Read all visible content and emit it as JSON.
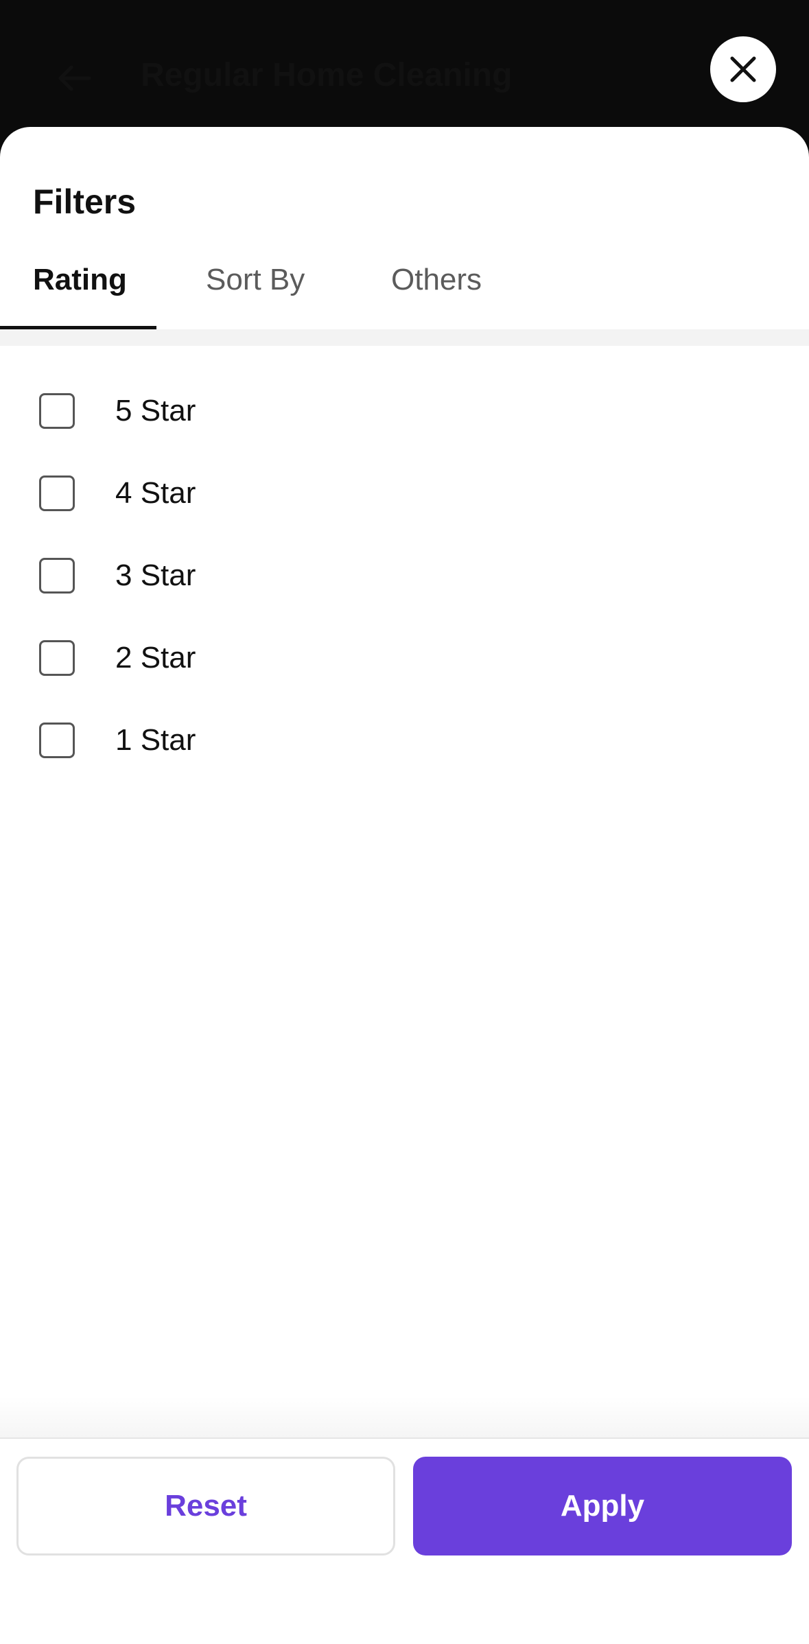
{
  "header": {
    "title": "Regular Home Cleaning",
    "back_icon": "arrow-left-icon",
    "close_icon": "close-icon"
  },
  "sheet": {
    "title": "Filters",
    "tabs": [
      {
        "label": "Rating",
        "active": true
      },
      {
        "label": "Sort By",
        "active": false
      },
      {
        "label": "Others",
        "active": false
      }
    ],
    "rating_options": [
      {
        "label": "5 Star",
        "checked": false
      },
      {
        "label": "4 Star",
        "checked": false
      },
      {
        "label": "3 Star",
        "checked": false
      },
      {
        "label": "2 Star",
        "checked": false
      },
      {
        "label": "1 Star",
        "checked": false
      }
    ]
  },
  "footer": {
    "reset_label": "Reset",
    "apply_label": "Apply"
  },
  "colors": {
    "accent": "#6a3fdc",
    "backdrop": "#0b0b0b",
    "text": "#111111"
  }
}
